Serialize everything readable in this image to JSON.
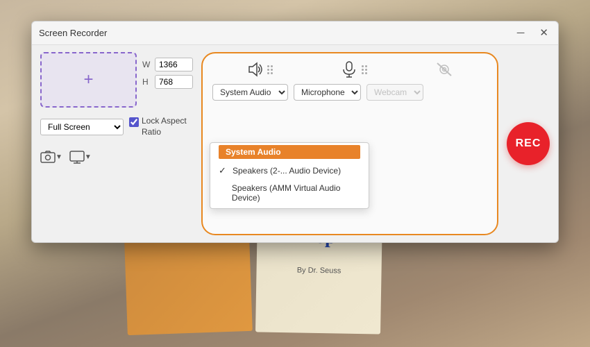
{
  "window": {
    "title": "Screen Recorder",
    "close_btn": "✕",
    "minimize_btn": "─"
  },
  "left_panel": {
    "plus_icon": "+",
    "width_label": "W",
    "height_label": "H",
    "width_value": "1366",
    "height_value": "768",
    "fullscreen_option": "Full Screen",
    "lock_checked": true,
    "lock_label": "Lock Aspect Ratio",
    "screenshot_icon": "📷",
    "video_icon": "🎬"
  },
  "av_panel": {
    "system_audio_options": [
      "Speakers (2-...",
      "Speakers (AMM Virtual Audio Device)"
    ],
    "system_audio_selected": "System Audio",
    "microphone_selected": "Microphone",
    "webcam_selected": "Webcam",
    "webcam_disabled": true,
    "dropdown_header": "System Audio",
    "dropdown_items": [
      {
        "label": "Speakers (2-... Audio Device)",
        "checked": true
      },
      {
        "label": "Speakers (AMM Virtual Audio Device)",
        "checked": false
      }
    ]
  },
  "rec_button": {
    "label": "REC"
  }
}
